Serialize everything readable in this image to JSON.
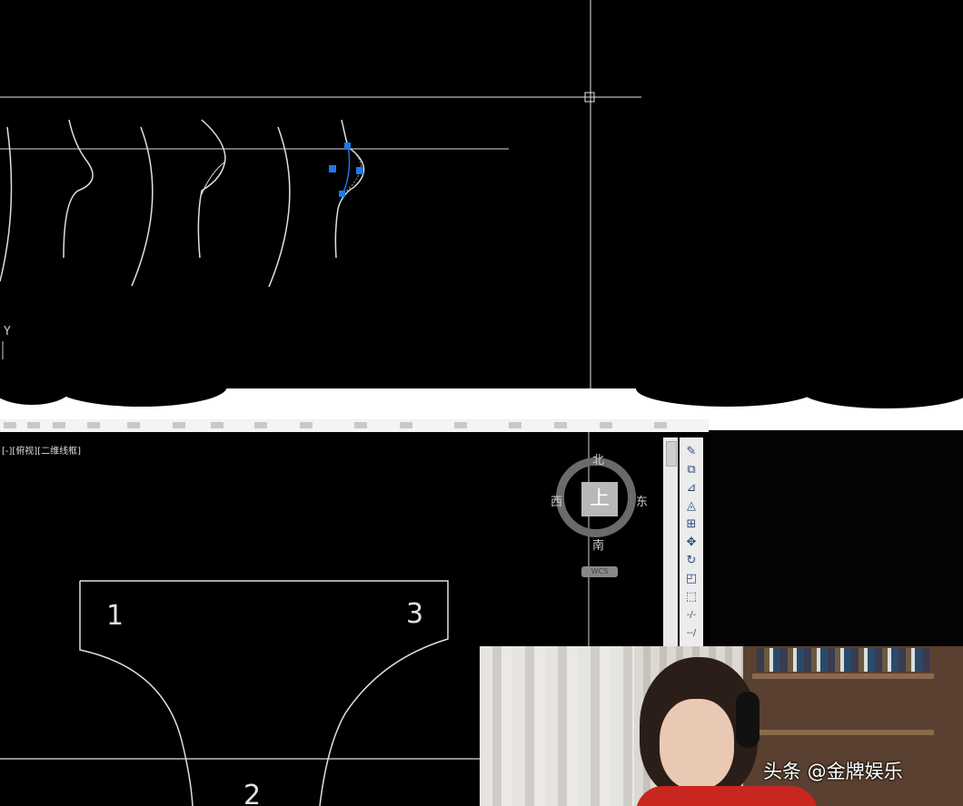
{
  "top_viewport": {
    "axis_label": "Y"
  },
  "bottom_viewport": {
    "label": "[-][俯视][二维线框]",
    "shape_numbers": [
      "1",
      "3",
      "2"
    ]
  },
  "viewcube": {
    "north": "北",
    "south": "南",
    "east": "东",
    "west": "西",
    "face": "上",
    "wcs_label": "WCS"
  },
  "modify_toolbar": {
    "tools": [
      {
        "icon": "erase-icon",
        "glyph": "✎"
      },
      {
        "icon": "copy-icon",
        "glyph": "⧉"
      },
      {
        "icon": "mirror-icon",
        "glyph": "⊿"
      },
      {
        "icon": "offset-icon",
        "glyph": "◬"
      },
      {
        "icon": "array-icon",
        "glyph": "⊞"
      },
      {
        "icon": "move-icon",
        "glyph": "✥"
      },
      {
        "icon": "rotate-icon",
        "glyph": "↻"
      },
      {
        "icon": "scale-icon",
        "glyph": "◰"
      },
      {
        "icon": "stretch-icon",
        "glyph": "⬚"
      },
      {
        "icon": "trim-icon",
        "glyph": "-/-"
      },
      {
        "icon": "extend-icon",
        "glyph": "--/"
      }
    ]
  },
  "webcam": {
    "watermark": "头条 @金牌娱乐"
  },
  "colors": {
    "background": "#000000",
    "cad_line": "#e0e0e0",
    "grip": "#1e78e6"
  }
}
